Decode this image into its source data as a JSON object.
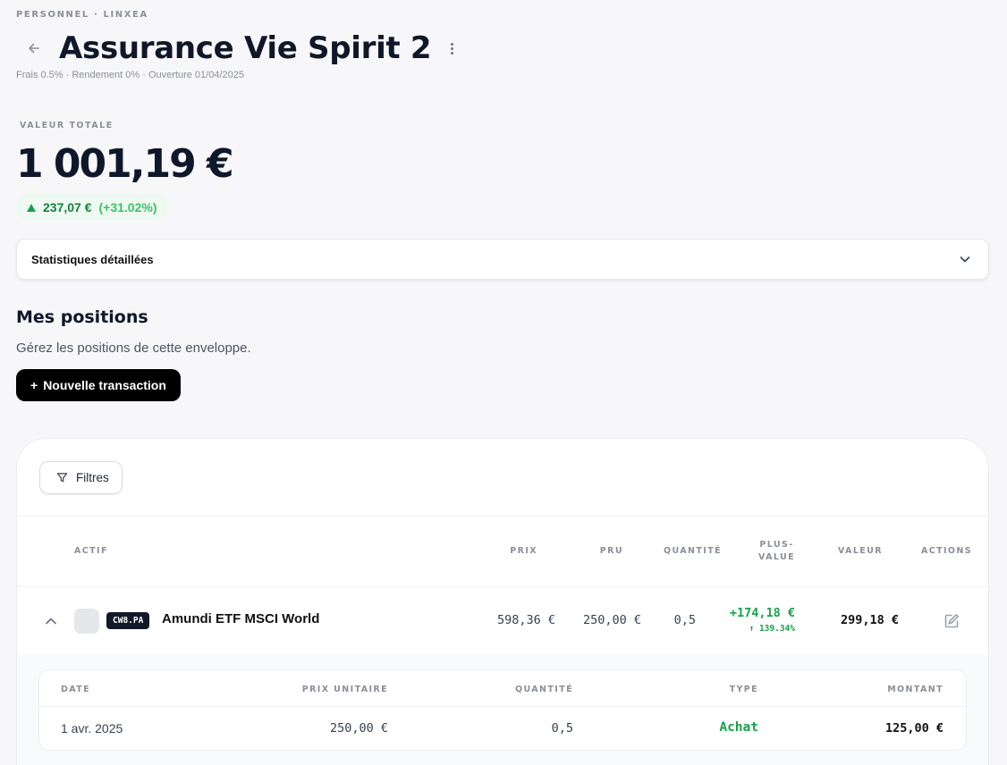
{
  "header": {
    "breadcrumb": "PERSONNEL · LINXEA",
    "title": "Assurance Vie Spirit 2",
    "subtitle": "Frais 0.5% · Rendement 0% · Ouverture 01/04/2025"
  },
  "summary": {
    "total_label": "VALEUR TOTALE",
    "total_value": "1 001,19 €",
    "gain_amount": "237,07 €",
    "gain_percent": "(+31.02%)",
    "gain_color": "#16a34a"
  },
  "stats": {
    "label": "Statistiques détaillées"
  },
  "positions": {
    "title": "Mes positions",
    "subtitle": "Gérez les positions de cette enveloppe.",
    "new_transaction_label": "Nouvelle transaction",
    "filters_label": "Filtres",
    "columns": {
      "asset": "ACTIF",
      "price": "PRIX",
      "pru": "PRU",
      "quantity": "QUANTITÉ",
      "gain_line1": "PLUS-",
      "gain_line2": "VALUE",
      "value": "VALEUR",
      "actions": "ACTIONS"
    },
    "rows": [
      {
        "ticker": "CW8.PA",
        "name": "Amundi ETF MSCI World",
        "price": "598,36 €",
        "pru": "250,00 €",
        "quantity": "0,5",
        "gain": "+174,18 €",
        "gain_percent": "↑ 139.34%",
        "value": "299,18 €",
        "transactions": {
          "columns": {
            "date": "DATE",
            "unit_price": "PRIX UNITAIRE",
            "quantity": "QUANTITÉ",
            "type": "TYPE",
            "amount": "MONTANT"
          },
          "rows": [
            {
              "date": "1 avr. 2025",
              "unit_price": "250,00 €",
              "quantity": "0,5",
              "type": "Achat",
              "amount": "125,00 €"
            }
          ]
        }
      }
    ]
  }
}
